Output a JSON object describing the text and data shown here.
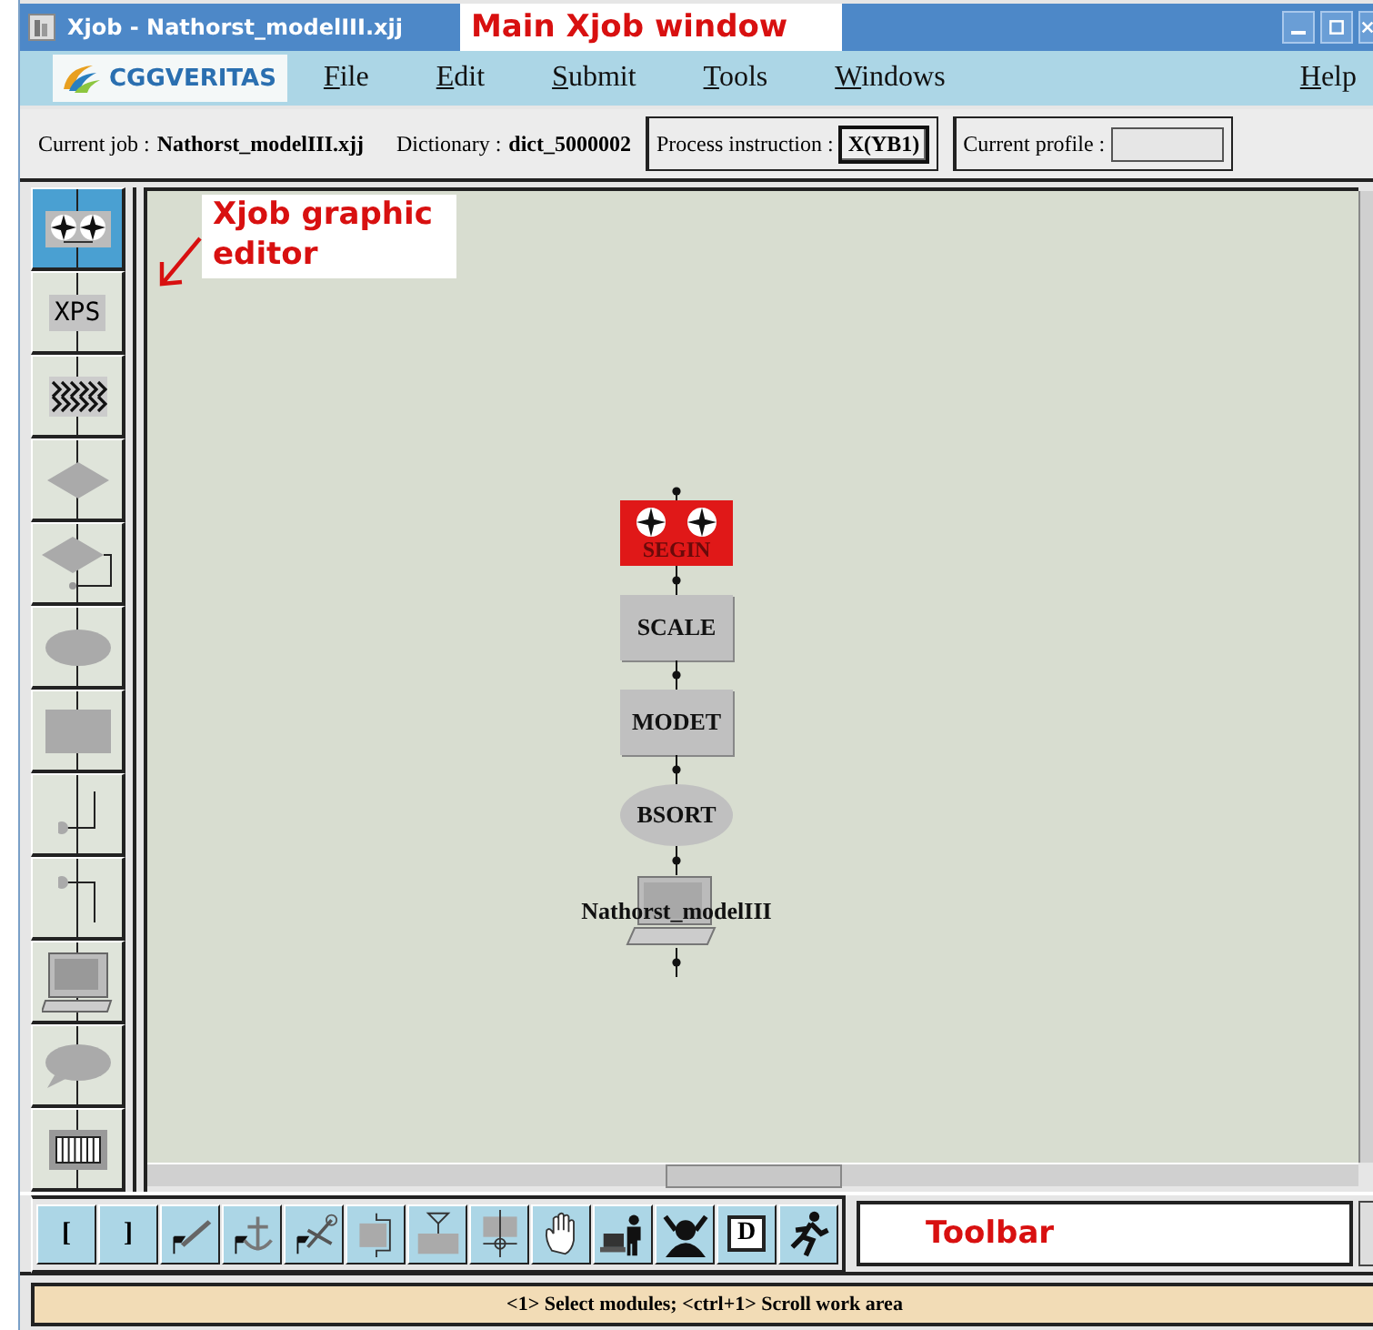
{
  "window": {
    "title": "Xjob - Nathorst_modelIII.xjj"
  },
  "annotations": [
    {
      "text": "Main Xjob window",
      "kind": "title"
    },
    {
      "text": "Xjob graphic editor",
      "kind": "editor"
    },
    {
      "text": "Toolbar",
      "kind": "toolbar"
    }
  ],
  "logo_text": "CGGVERITAS",
  "menu": [
    "File",
    "Edit",
    "Submit",
    "Tools",
    "Windows",
    "Help"
  ],
  "info": {
    "job_label": "Current job :",
    "job": "Nathorst_modelIII.xjj",
    "dict_label": "Dictionary :",
    "dict": "dict_5000002",
    "instruction_label": "Process instruction :",
    "instruction": "X(YB1)",
    "profile_label": "Current profile :"
  },
  "palette": [
    {
      "kind": "begin",
      "selected": true
    },
    {
      "kind": "xps",
      "label": "XPS",
      "selected": false
    },
    {
      "kind": "chevrons",
      "selected": false
    },
    {
      "kind": "diamond",
      "selected": false
    },
    {
      "kind": "diamond-loop",
      "selected": false
    },
    {
      "kind": "ellipse",
      "selected": false
    },
    {
      "kind": "rect",
      "selected": false
    },
    {
      "kind": "branch",
      "selected": false
    },
    {
      "kind": "branch-low",
      "selected": false
    },
    {
      "kind": "terminal",
      "selected": false
    },
    {
      "kind": "bubble",
      "selected": false
    },
    {
      "kind": "rack",
      "selected": false
    }
  ],
  "nodes": [
    {
      "kind": "begin",
      "label": "SEGIN"
    },
    {
      "kind": "rect",
      "label": "SCALE"
    },
    {
      "kind": "rect",
      "label": "MODET"
    },
    {
      "kind": "ellipse",
      "label": "BSORT"
    },
    {
      "kind": "terminal",
      "label": "Nathorst_modelIII"
    }
  ],
  "toolbar": [
    {
      "kind": "text",
      "label": "["
    },
    {
      "kind": "text",
      "label": "]"
    },
    {
      "kind": "pen"
    },
    {
      "kind": "anchor"
    },
    {
      "kind": "scissors"
    },
    {
      "kind": "bracket-box"
    },
    {
      "kind": "filter-box"
    },
    {
      "kind": "cross-box"
    },
    {
      "kind": "hand"
    },
    {
      "kind": "person-computer"
    },
    {
      "kind": "person-cheer"
    },
    {
      "kind": "letter",
      "label": "D"
    },
    {
      "kind": "runner"
    }
  ],
  "status_bar": "<1> Select modules; <ctrl+1> Scroll work area"
}
